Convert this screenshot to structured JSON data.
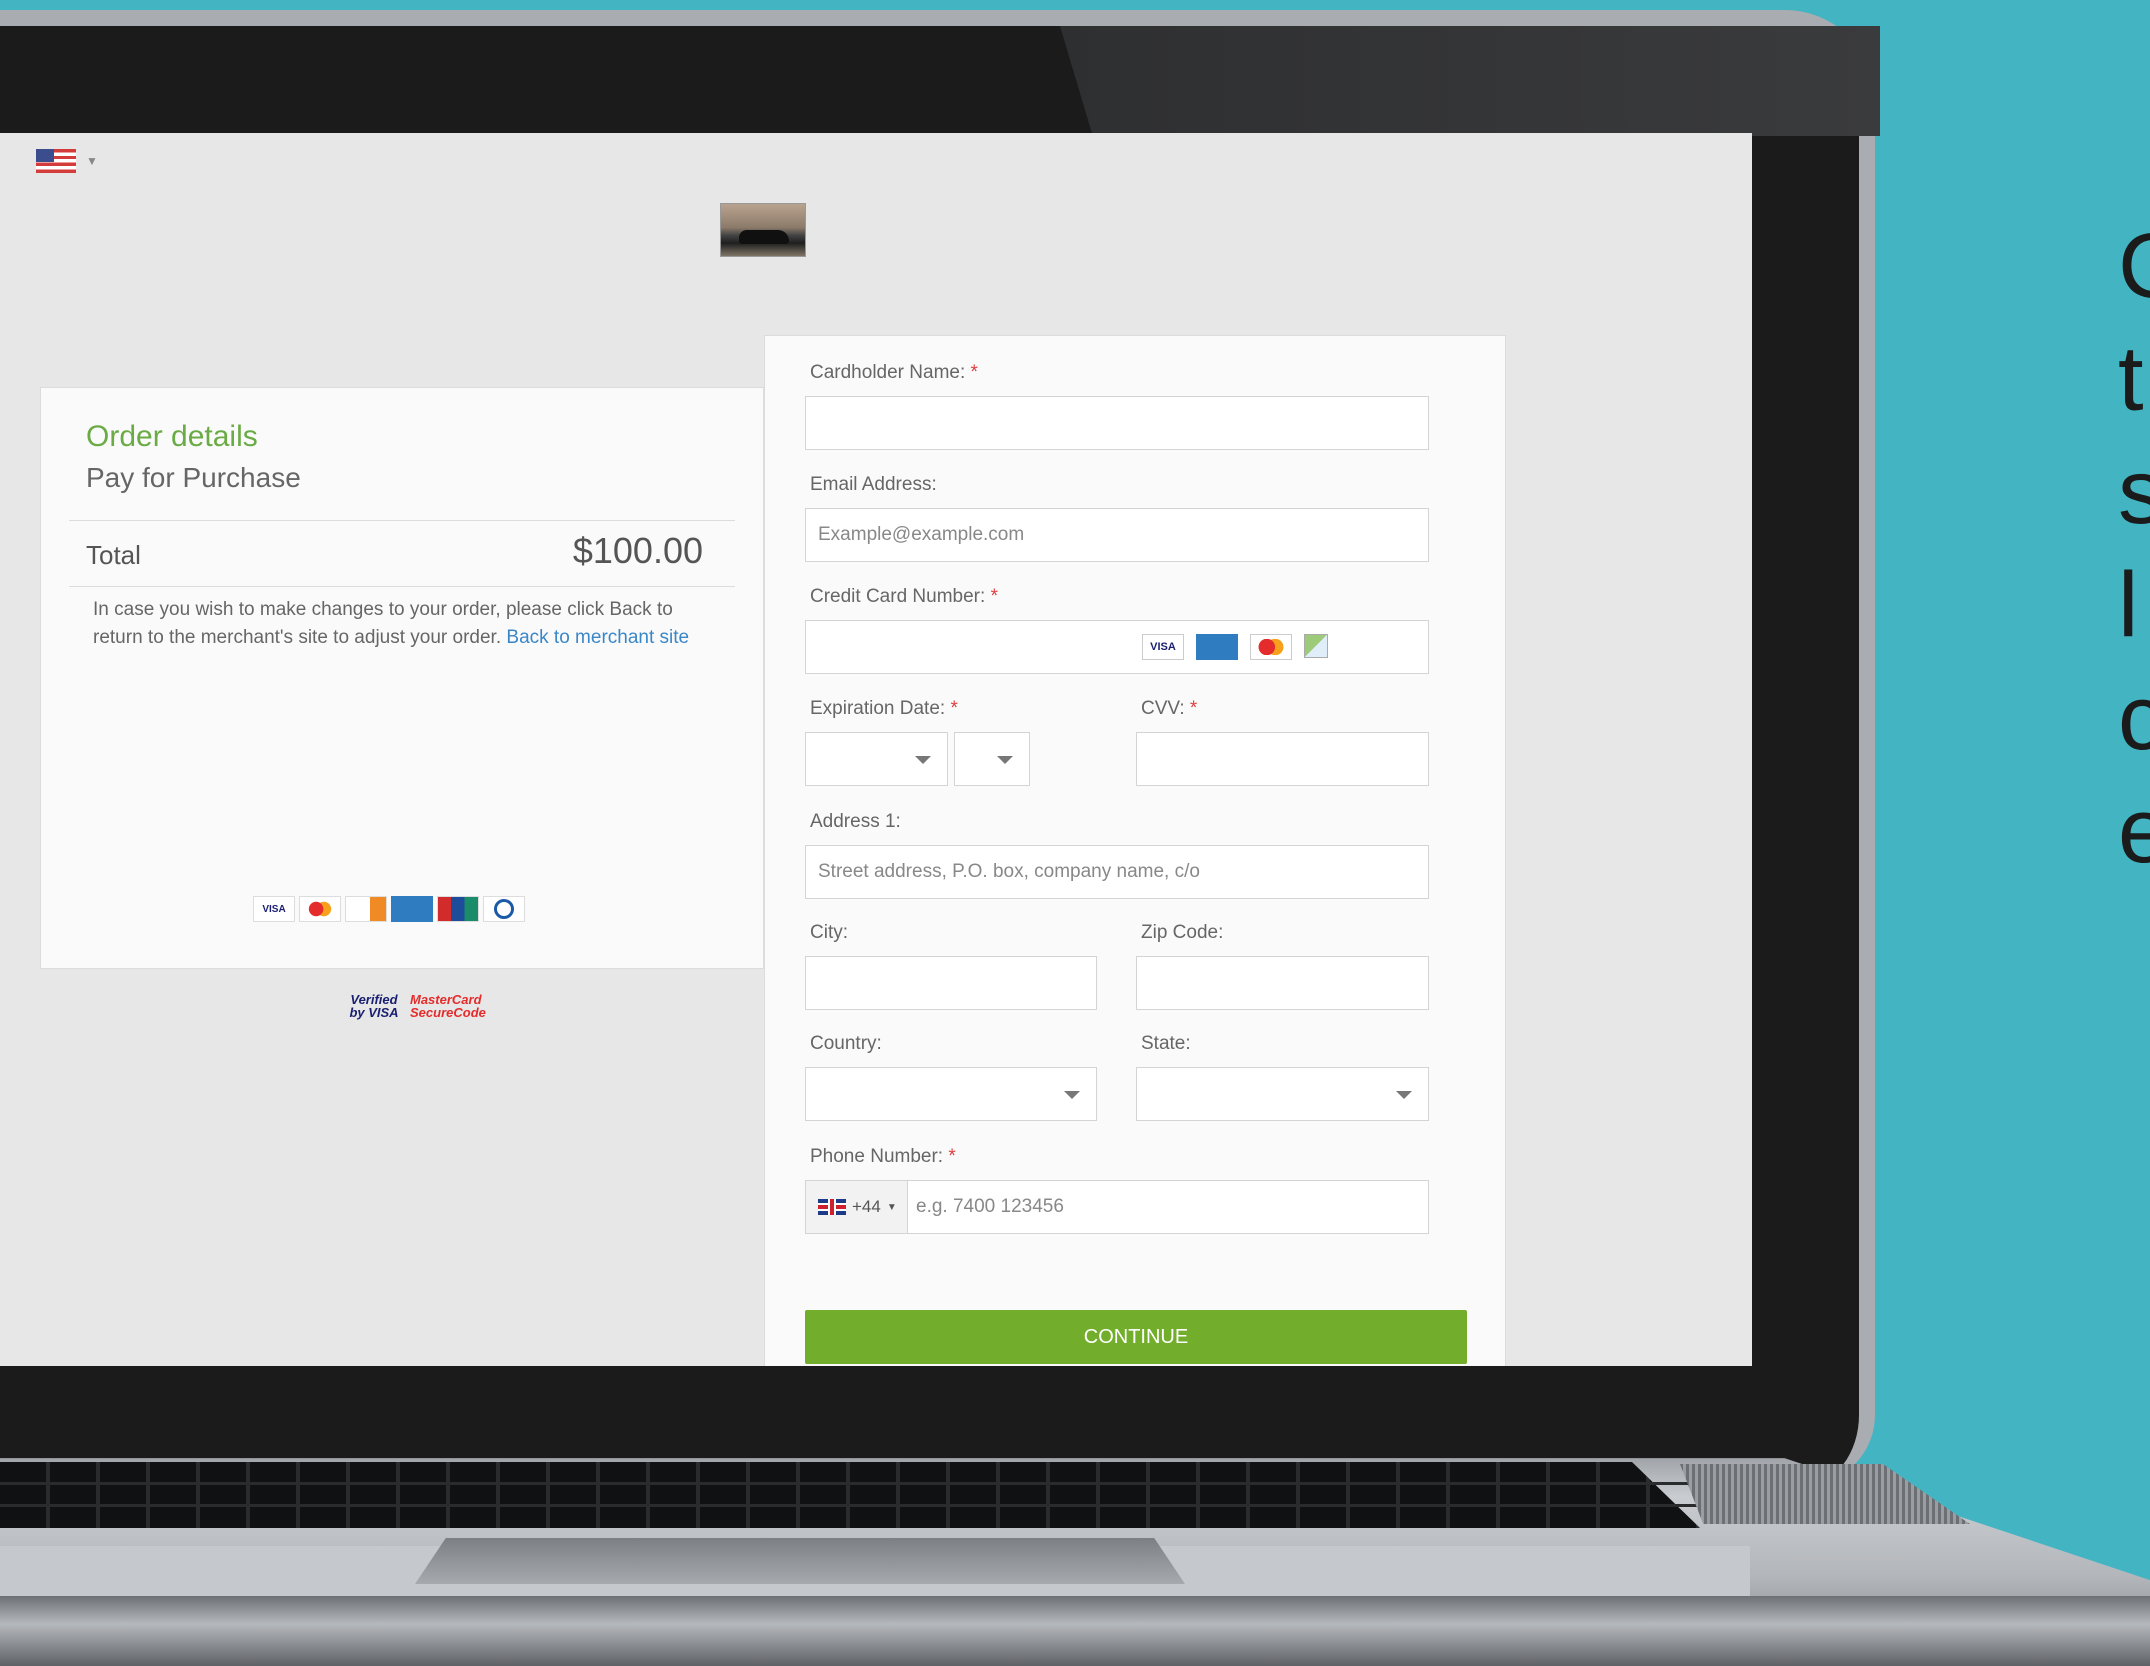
{
  "order": {
    "title": "Order details",
    "subtitle": "Pay for Purchase",
    "total_label": "Total",
    "total_value": "$100.00",
    "note": "In case you wish to make changes to your order, please click Back to return to the merchant's site to adjust your order.",
    "back_link": "Back to merchant site",
    "card_logos": [
      "visa",
      "mastercard",
      "discover",
      "american-express",
      "unionpay",
      "diners-club"
    ],
    "verified_visa": "Verified by VISA",
    "mc_securecode": "MasterCard SecureCode"
  },
  "form": {
    "cardholder_label": "Cardholder Name:",
    "email_label": "Email Address:",
    "email_placeholder": "Example@example.com",
    "card_number_label": "Credit Card Number:",
    "expiration_label": "Expiration Date:",
    "cvv_label": "CVV:",
    "address_label": "Address 1:",
    "address_placeholder": "Street address, P.O. box, company name, c/o",
    "city_label": "City:",
    "zip_label": "Zip Code:",
    "country_label": "Country:",
    "state_label": "State:",
    "phone_label": "Phone Number:",
    "phone_code": "+44",
    "phone_placeholder": "e.g. 7400 123456",
    "required_mark": "*",
    "continue_label": "CONTINUE"
  },
  "side_text": [
    "C",
    "t",
    "s",
    "l",
    "c",
    "e"
  ],
  "colors": {
    "accent_green": "#72ad2b",
    "title_green": "#6aab45",
    "link_blue": "#3a87c8",
    "background_teal": "#42b4c2"
  }
}
